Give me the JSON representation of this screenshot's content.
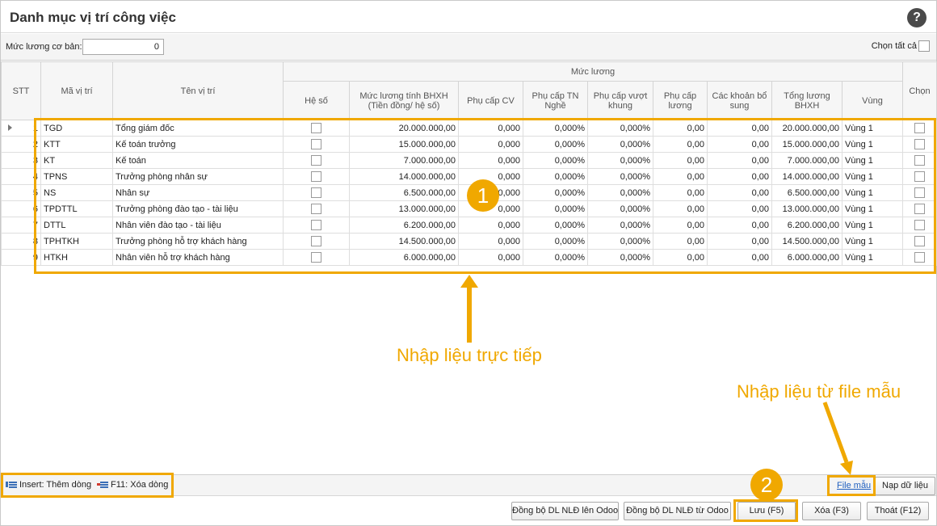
{
  "window": {
    "title": "Danh mục vị trí công việc",
    "help_icon": "?"
  },
  "filter": {
    "base_salary_label": "Mức lương cơ bản:",
    "base_salary_value": "0",
    "select_all_label": "Chọn tất cả"
  },
  "columns": {
    "stt": "STT",
    "code": "Mã vị trí",
    "name": "Tên vị trí",
    "group": "Mức lương",
    "coef": "Hệ số",
    "bhxh": "Mức lương tính BHXH (Tiền đồng/ hệ số)",
    "pc_cv": "Phụ cấp CV",
    "pc_tn": "Phụ cấp TN Nghề",
    "pc_vk": "Phụ cấp vượt khung",
    "pc_luong": "Phụ cấp lương",
    "bosung": "Các khoản bổ sung",
    "tong": "Tổng lương BHXH",
    "vung": "Vùng",
    "chon": "Chọn"
  },
  "rows": [
    {
      "stt": "1",
      "code": "TGD",
      "name": "Tổng giám đốc",
      "bhxh": "20.000.000,00",
      "pc_cv": "0,000",
      "pc_tn": "0,000%",
      "pc_vk": "0,000%",
      "pc_luong": "0,00",
      "bosung": "0,00",
      "tong": "20.000.000,00",
      "vung": "Vùng 1"
    },
    {
      "stt": "2",
      "code": "KTT",
      "name": "Kế toán trưởng",
      "bhxh": "15.000.000,00",
      "pc_cv": "0,000",
      "pc_tn": "0,000%",
      "pc_vk": "0,000%",
      "pc_luong": "0,00",
      "bosung": "0,00",
      "tong": "15.000.000,00",
      "vung": "Vùng 1"
    },
    {
      "stt": "3",
      "code": "KT",
      "name": "Kế toán",
      "bhxh": "7.000.000,00",
      "pc_cv": "0,000",
      "pc_tn": "0,000%",
      "pc_vk": "0,000%",
      "pc_luong": "0,00",
      "bosung": "0,00",
      "tong": "7.000.000,00",
      "vung": "Vùng 1"
    },
    {
      "stt": "4",
      "code": "TPNS",
      "name": "Trưởng phòng nhân sự",
      "bhxh": "14.000.000,00",
      "pc_cv": "0,000",
      "pc_tn": "0,000%",
      "pc_vk": "0,000%",
      "pc_luong": "0,00",
      "bosung": "0,00",
      "tong": "14.000.000,00",
      "vung": "Vùng 1"
    },
    {
      "stt": "5",
      "code": "NS",
      "name": "Nhân sự",
      "bhxh": "6.500.000,00",
      "pc_cv": "0,000",
      "pc_tn": "0,000%",
      "pc_vk": "0,000%",
      "pc_luong": "0,00",
      "bosung": "0,00",
      "tong": "6.500.000,00",
      "vung": "Vùng 1"
    },
    {
      "stt": "6",
      "code": "TPDTTL",
      "name": "Trưởng phòng đào tạo - tài liệu",
      "bhxh": "13.000.000,00",
      "pc_cv": "0,000",
      "pc_tn": "0,000%",
      "pc_vk": "0,000%",
      "pc_luong": "0,00",
      "bosung": "0,00",
      "tong": "13.000.000,00",
      "vung": "Vùng 1"
    },
    {
      "stt": "7",
      "code": "DTTL",
      "name": "Nhân viên đào tạo - tài liệu",
      "bhxh": "6.200.000,00",
      "pc_cv": "0,000",
      "pc_tn": "0,000%",
      "pc_vk": "0,000%",
      "pc_luong": "0,00",
      "bosung": "0,00",
      "tong": "6.200.000,00",
      "vung": "Vùng 1"
    },
    {
      "stt": "8",
      "code": "TPHTKH",
      "name": "Trưởng phòng hỗ trợ khách hàng",
      "bhxh": "14.500.000,00",
      "pc_cv": "0,000",
      "pc_tn": "0,000%",
      "pc_vk": "0,000%",
      "pc_luong": "0,00",
      "bosung": "0,00",
      "tong": "14.500.000,00",
      "vung": "Vùng 1"
    },
    {
      "stt": "9",
      "code": "HTKH",
      "name": "Nhân viên hỗ trợ khách hàng",
      "bhxh": "6.000.000,00",
      "pc_cv": "0,000",
      "pc_tn": "0,000%",
      "pc_vk": "0,000%",
      "pc_luong": "0,00",
      "bosung": "0,00",
      "tong": "6.000.000,00",
      "vung": "Vùng 1"
    }
  ],
  "status": {
    "insert_label": "Insert: Thêm dòng",
    "delete_label": "F11: Xóa dòng"
  },
  "actions": {
    "file_template": "File mẫu",
    "load_data": "Nạp dữ liệu",
    "sync_to_odoo": "Đồng bộ DL NLĐ lên Odoo",
    "sync_from_odoo": "Đồng bộ DL NLĐ từ Odoo",
    "save": "Lưu (F5)",
    "delete": "Xóa (F3)",
    "exit": "Thoát (F12)"
  },
  "annotations": {
    "badge_1": "1",
    "badge_2": "2",
    "direct_entry": "Nhập liệu trực tiếp",
    "file_entry": "Nhập liệu từ file mẫu",
    "accent_color": "#f0a800"
  }
}
